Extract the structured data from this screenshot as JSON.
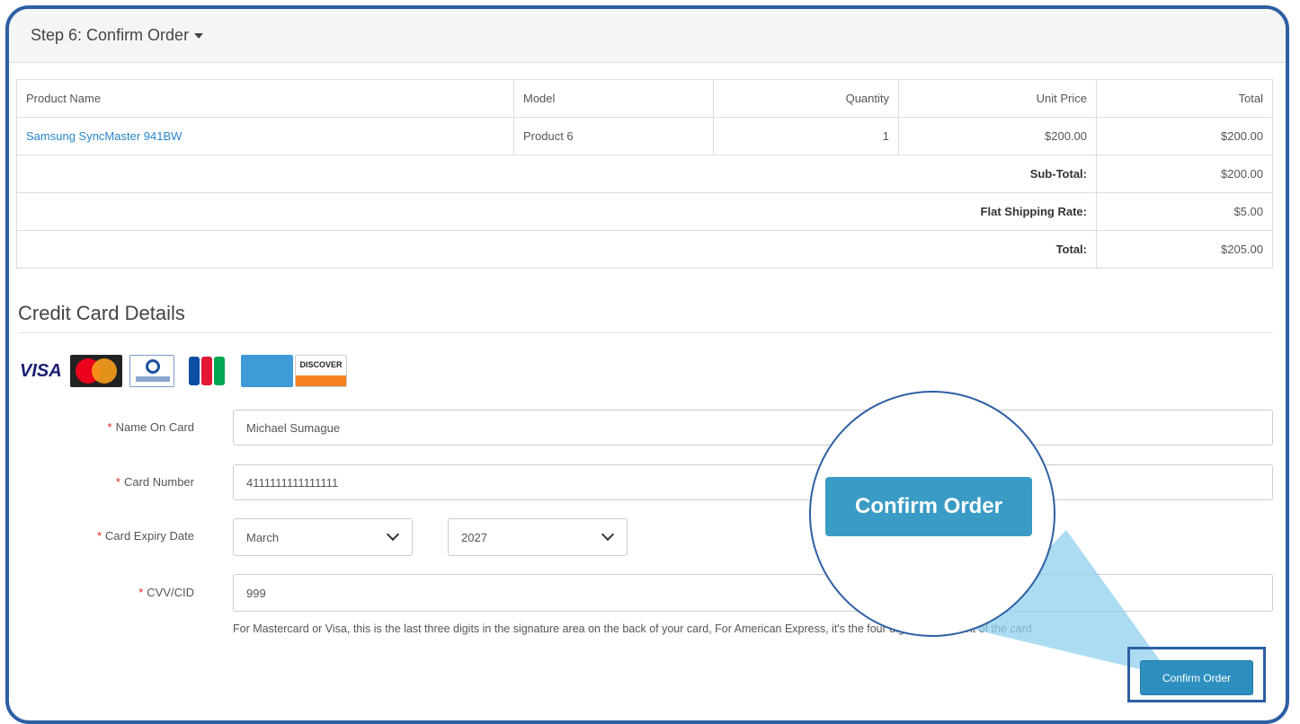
{
  "panel": {
    "title": "Step 6: Confirm Order"
  },
  "table": {
    "headers": [
      "Product Name",
      "Model",
      "Quantity",
      "Unit Price",
      "Total"
    ],
    "row": {
      "product": "Samsung SyncMaster 941BW",
      "model": "Product 6",
      "quantity": "1",
      "unit_price": "$200.00",
      "total": "$200.00"
    },
    "totals": [
      {
        "label": "Sub-Total:",
        "value": "$200.00"
      },
      {
        "label": "Flat Shipping Rate:",
        "value": "$5.00"
      },
      {
        "label": "Total:",
        "value": "$205.00"
      }
    ]
  },
  "credit_card": {
    "heading": "Credit Card Details",
    "card_logos": [
      "VISA",
      "MasterCard",
      "Diners Club",
      "JCB",
      "American Express",
      "DISCOVER"
    ],
    "name_label": "Name On Card",
    "name_value": "Michael Sumague",
    "number_label": "Card Number",
    "number_value": "4111111111111111",
    "expiry_label": "Card Expiry Date",
    "expiry_month": "March",
    "expiry_year": "2027",
    "cvv_label": "CVV/CID",
    "cvv_value": "999",
    "help_text": "For Mastercard or Visa, this is the last three digits in the signature area on the back of your card, For American Express, it's the four digits on the front of the card"
  },
  "confirm_button": {
    "label": "Confirm Order"
  },
  "magnifier": {
    "label": "Confirm Order"
  },
  "colors": {
    "accent": "#2d8fc0",
    "frame": "#2d5fa3",
    "link": "#2a85c9",
    "required": "#e0231e"
  }
}
